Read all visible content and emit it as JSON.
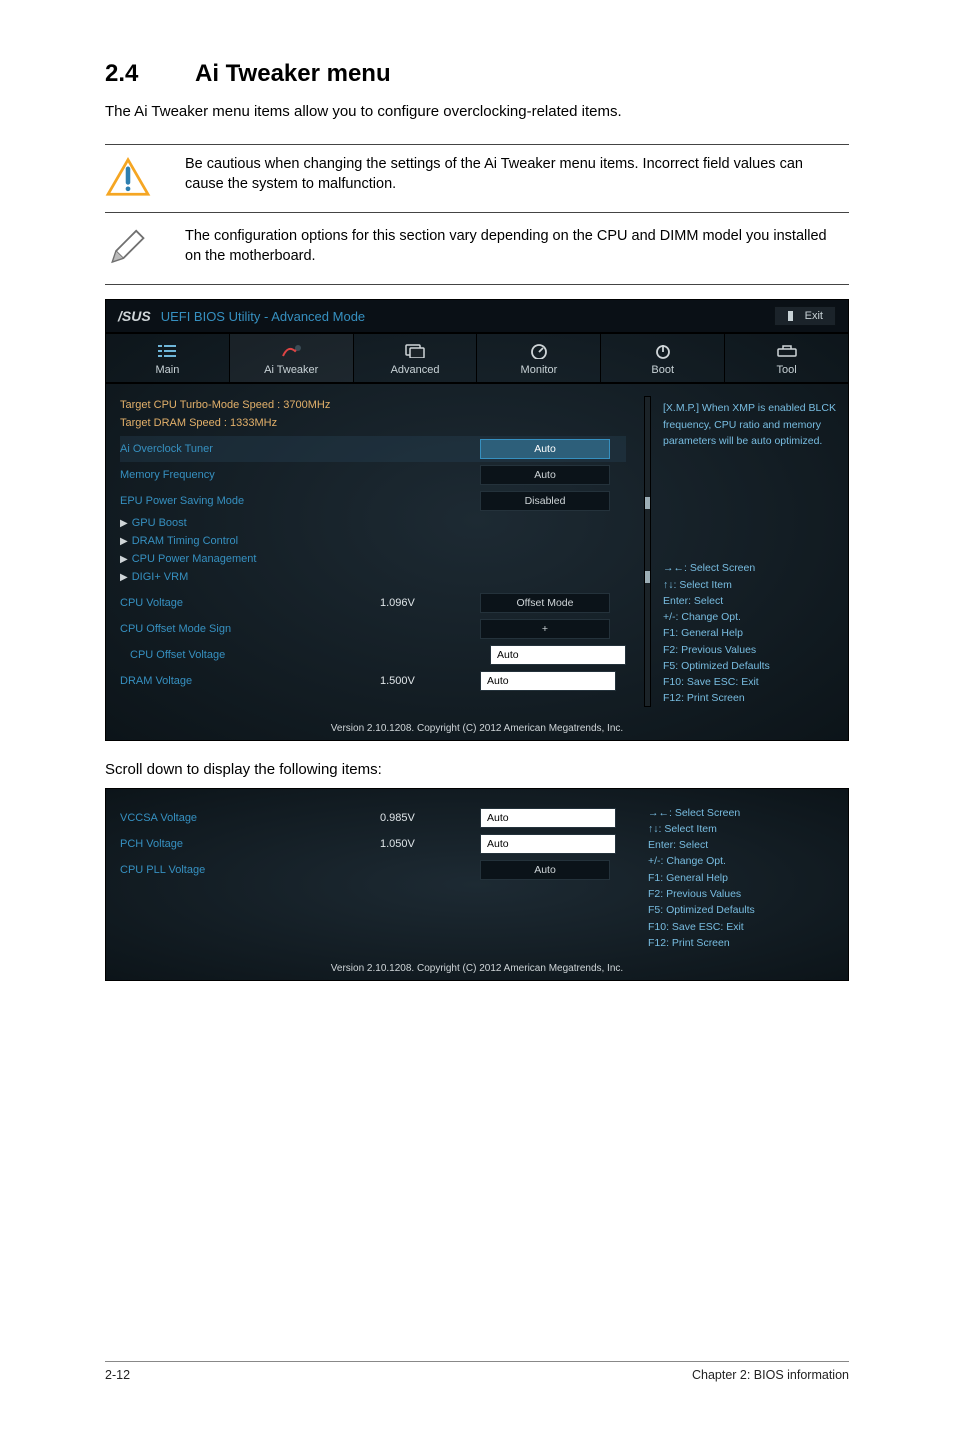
{
  "page": {
    "section_number": "2.4",
    "section_title": "Ai Tweaker menu",
    "intro": "The Ai Tweaker menu items allow you to configure overclocking-related items.",
    "caution": "Be cautious when changing the settings of the Ai Tweaker menu items. Incorrect field values can cause the system to malfunction.",
    "note": "The configuration options for this section vary depending on the CPU and DIMM model you installed on the motherboard.",
    "scroll_text": "Scroll down to display the following items:",
    "footer_left": "2-12",
    "footer_right": "Chapter 2: BIOS information"
  },
  "bios": {
    "brand": "/SUS",
    "title": "UEFI BIOS Utility - Advanced Mode",
    "exit": "Exit",
    "tabs": {
      "main": "Main",
      "tweaker": "Ai  Tweaker",
      "advanced": "Advanced",
      "monitor": "Monitor",
      "boot": "Boot",
      "tool": "Tool"
    },
    "target_cpu": "Target CPU Turbo-Mode Speed : 3700MHz",
    "target_dram": "Target DRAM Speed : 1333MHz",
    "rows": {
      "ai_overclock": {
        "label": "Ai Overclock Tuner",
        "val": "Auto"
      },
      "mem_freq": {
        "label": "Memory Frequency",
        "val": "Auto"
      },
      "epu": {
        "label": "EPU Power Saving Mode",
        "val": "Disabled"
      },
      "gpu_boost": "GPU Boost",
      "dram_timing": "DRAM Timing Control",
      "cpu_pm": "CPU Power Management",
      "digi": "DIGI+ VRM",
      "cpu_voltage": {
        "label": "CPU Voltage",
        "num": "1.096V",
        "val": "Offset Mode"
      },
      "offset_sign": {
        "label": "CPU Offset Mode Sign",
        "val": "+"
      },
      "offset_voltage": {
        "label": "CPU Offset Voltage",
        "val": "Auto"
      },
      "dram_voltage": {
        "label": "DRAM Voltage",
        "num": "1.500V",
        "val": "Auto"
      }
    },
    "help_xmp": "[X.M.P.] When XMP is enabled BLCK frequency, CPU ratio and memory parameters will be auto optimized.",
    "help_keys": {
      "l1": "→←: Select Screen",
      "l2": "↑↓: Select Item",
      "l3": "Enter: Select",
      "l4": "+/-: Change Opt.",
      "l5": "F1: General Help",
      "l6": "F2: Previous Values",
      "l7": "F5: Optimized Defaults",
      "l8": "F10: Save   ESC: Exit",
      "l9": "F12: Print Screen"
    },
    "footer": "Version  2.10.1208.   Copyright  (C)  2012  American  Megatrends,  Inc."
  },
  "bios2": {
    "rows": {
      "vccsa": {
        "label": "VCCSA Voltage",
        "num": "0.985V",
        "val": "Auto"
      },
      "pch": {
        "label": "PCH Voltage",
        "num": "1.050V",
        "val": "Auto"
      },
      "cpu_pll": {
        "label": "CPU PLL Voltage",
        "val": "Auto"
      }
    }
  }
}
